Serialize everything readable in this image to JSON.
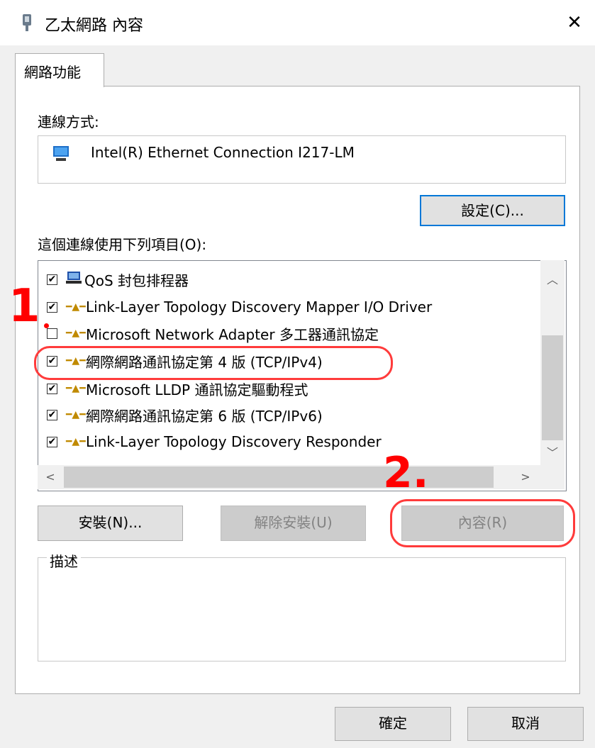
{
  "window": {
    "title": "乙太網路 內容",
    "close_glyph": "✕"
  },
  "tab": {
    "label": "網路功能"
  },
  "connection": {
    "label": "連線方式:",
    "adapter": "Intel(R) Ethernet Connection I217-LM",
    "configure_button": "設定(C)..."
  },
  "items": {
    "label": "這個連線使用下列項目(O):",
    "list": [
      {
        "name": "QoS 封包排程器",
        "checked": true,
        "icon": "qos-scheduler-icon"
      },
      {
        "name": "Link-Layer Topology Discovery Mapper I/O Driver",
        "checked": true,
        "icon": "protocol-icon"
      },
      {
        "name": "Microsoft Network Adapter 多工器通訊協定",
        "checked": false,
        "icon": "protocol-icon"
      },
      {
        "name": "網際網路通訊協定第 4 版 (TCP/IPv4)",
        "checked": true,
        "icon": "protocol-icon"
      },
      {
        "name": "Microsoft LLDP 通訊協定驅動程式",
        "checked": true,
        "icon": "protocol-icon"
      },
      {
        "name": "網際網路通訊協定第 6 版 (TCP/IPv6)",
        "checked": true,
        "icon": "protocol-icon"
      },
      {
        "name": "Link-Layer Topology Discovery Responder",
        "checked": true,
        "icon": "protocol-icon"
      }
    ]
  },
  "buttons": {
    "install": "安裝(N)...",
    "uninstall": "解除安裝(U)",
    "properties": "內容(R)",
    "ok": "確定",
    "cancel": "取消"
  },
  "description": {
    "label": "描述"
  },
  "annotations": {
    "step1": "1",
    "step2": "2.",
    "color": "#ff0000"
  }
}
